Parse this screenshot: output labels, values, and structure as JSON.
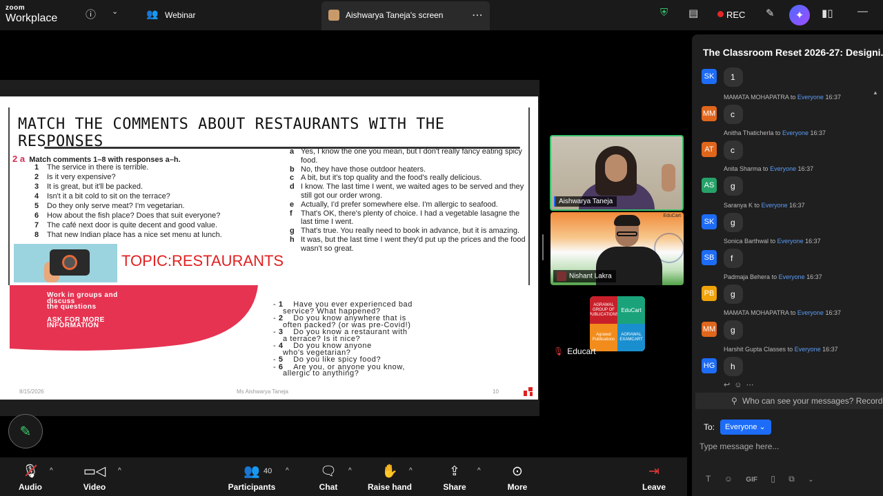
{
  "topbar": {
    "brand_line1": "zoom",
    "brand_line2": "Workplace",
    "webinar_label": "Webinar",
    "share_tab_label": "Aishwarya Taneja's screen",
    "rec_label": "REC"
  },
  "slide": {
    "title": "MATCH THE COMMENTS ABOUT RESTAURANTS WITH THE RESPONSES",
    "exercise_num": "2 a",
    "exercise_head": "Match comments 1–8 with responses a–h.",
    "comments": [
      {
        "n": "1",
        "text": "The service in there is terrible."
      },
      {
        "n": "2",
        "text": "Is it very expensive?"
      },
      {
        "n": "3",
        "text": "It is great, but it'll be packed."
      },
      {
        "n": "4",
        "text": "Isn't it a bit cold to sit on the terrace?"
      },
      {
        "n": "5",
        "text": "Do they only serve meat? I'm vegetarian."
      },
      {
        "n": "6",
        "text": "How about the fish place? Does that suit everyone?"
      },
      {
        "n": "7",
        "text": "The café next door is quite decent and good value."
      },
      {
        "n": "8",
        "text": "That new Indian place has a nice set menu at lunch."
      }
    ],
    "responses": [
      {
        "l": "a",
        "text": "Yes, I know the one you mean, but I don't really fancy eating spicy food."
      },
      {
        "l": "b",
        "text": "No, they have those outdoor heaters."
      },
      {
        "l": "c",
        "text": "A bit, but it's top quality and the food's really delicious."
      },
      {
        "l": "d",
        "text": "I know. The last time I went, we waited ages to be served and they still got our order wrong."
      },
      {
        "l": "e",
        "text": "Actually, I'd prefer somewhere else. I'm allergic to seafood."
      },
      {
        "l": "f",
        "text": "That's OK, there's plenty of choice. I had a vegetable lasagne the last time I went."
      },
      {
        "l": "g",
        "text": "That's true. You really need to book in advance, but it is amazing."
      },
      {
        "l": "h",
        "text": "It was, but the last time I went they'd put up the prices and the food wasn't so great."
      }
    ],
    "topic": "TOPIC:RESTAURANTS",
    "group_lines": [
      "Work in groups and",
      "discuss",
      "the questions"
    ],
    "ask_lines": [
      "ASK FOR MORE",
      "INFORMATION"
    ],
    "questions": [
      {
        "n": "1",
        "text": "Have you ever experienced bad",
        "text2": "service? What happened?"
      },
      {
        "n": "2",
        "text": "Do you know anywhere that is",
        "text2": "often packed? (or was pre-Covid!)"
      },
      {
        "n": "3",
        "text": "Do you know a restaurant with",
        "text2": "a terrace? Is it nice?"
      },
      {
        "n": "4",
        "text": "Do you know anyone",
        "text2": "who's vegetarian?"
      },
      {
        "n": "5",
        "text": "Do you like spicy food?",
        "text2": ""
      },
      {
        "n": "6",
        "text": "Are you, or anyone you know,",
        "text2": "allergic to anything?"
      }
    ],
    "footer_date": "8/15/2026",
    "footer_name": "Ms Aishwarya Taneja",
    "footer_page": "10"
  },
  "videos": {
    "aishwarya_name": "Aishwarya Taneja",
    "nishant_name": "Nishant Lakra",
    "educart_name": "Educart",
    "edu_mark": "EduCart",
    "logo_q1": "AGRAWAL GROUP OF PUBLICATIONS",
    "logo_q2": "EduCart",
    "logo_q3": "Agrawal Publications",
    "logo_q4": "AGRAWAL EXAMCART"
  },
  "chat": {
    "title": "The Classroom Reset 2026-27: Designi...",
    "messages": [
      {
        "initials": "SK",
        "color": "#1d6cf7",
        "sender": "",
        "to": "",
        "recipient": "",
        "time": "",
        "text": "1"
      },
      {
        "initials": "MM",
        "color": "#e0661c",
        "sender": "MAMATA MOHAPATRA",
        "to": "to",
        "recipient": "Everyone",
        "time": "16:37",
        "text": "c"
      },
      {
        "initials": "AT",
        "color": "#e0661c",
        "sender": "Anitha Thaticherla",
        "to": "to",
        "recipient": "Everyone",
        "time": "16:37",
        "text": "c"
      },
      {
        "initials": "AS",
        "color": "#26a269",
        "sender": "Anita Sharma",
        "to": "to",
        "recipient": "Everyone",
        "time": "16:37",
        "text": "g"
      },
      {
        "initials": "SK",
        "color": "#1d6cf7",
        "sender": "Saranya K",
        "to": "to",
        "recipient": "Everyone",
        "time": "16:37",
        "text": "g"
      },
      {
        "initials": "SB",
        "color": "#1d6cf7",
        "sender": "Sonica Barthwal",
        "to": "to",
        "recipient": "Everyone",
        "time": "16:37",
        "text": "f"
      },
      {
        "initials": "PB",
        "color": "#f0a30a",
        "sender": "Padmaja Behera",
        "to": "to",
        "recipient": "Everyone",
        "time": "16:37",
        "text": "g"
      },
      {
        "initials": "MM",
        "color": "#e0661c",
        "sender": "MAMATA MOHAPATRA",
        "to": "to",
        "recipient": "Everyone",
        "time": "16:37",
        "text": "g"
      },
      {
        "initials": "HG",
        "color": "#1d6cf7",
        "sender": "Harshit Gupta Classes",
        "to": "to",
        "recipient": "Everyone",
        "time": "16:37",
        "text": "h"
      }
    ],
    "notice": "Who can see your messages? Recording",
    "to_label": "To:",
    "to_value": "Everyone",
    "input_placeholder": "Type message here..."
  },
  "toolbar": {
    "audio": "Audio",
    "video": "Video",
    "participants": "Participants",
    "participants_count": "40",
    "chat": "Chat",
    "raise_hand": "Raise hand",
    "share": "Share",
    "more": "More",
    "leave": "Leave"
  },
  "colors": {
    "accent": "#1d6cf7",
    "active_speaker": "#35c26a",
    "rec": "#e02828",
    "slide_red": "#e63352",
    "topic_red": "#e02020"
  }
}
